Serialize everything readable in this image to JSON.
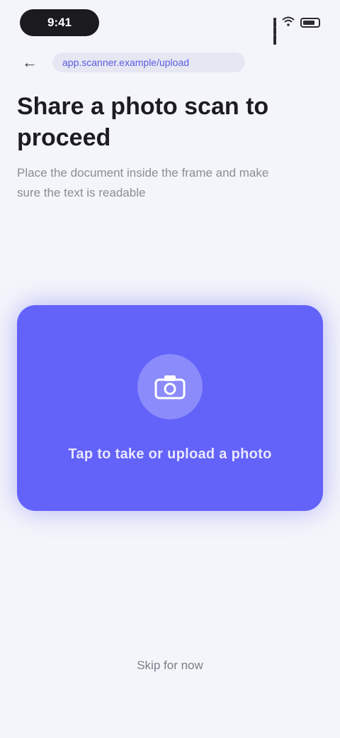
{
  "status_bar": {
    "time": "9:41"
  },
  "topbar": {
    "back_icon": "arrow-left-icon",
    "url": "app.scanner.example/upload"
  },
  "header": {
    "title": "Share a photo scan to proceed",
    "subtitle": "Place the document inside the frame and make sure the text is readable"
  },
  "upload": {
    "icon": "camera-icon",
    "label": "Tap to take or upload a photo",
    "accent_color": "#6362f9"
  },
  "footer": {
    "link_label": "Skip for now"
  }
}
